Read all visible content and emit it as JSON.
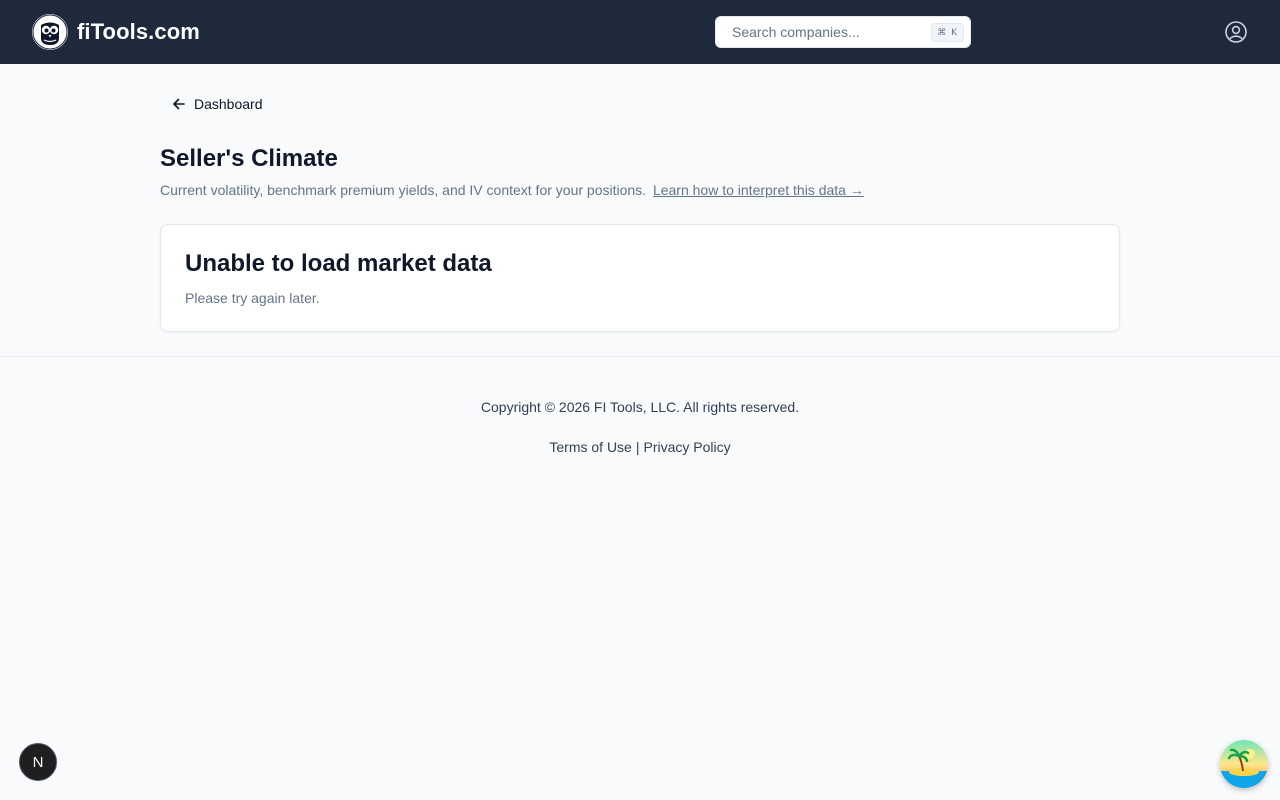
{
  "header": {
    "brand": "fiTools.com",
    "search_placeholder": "Search companies...",
    "shortcut": "⌘ K",
    "logo_icon": "owl-logo-icon",
    "user_icon": "user-circle-icon",
    "colors": {
      "background": "#1e293b",
      "text": "#ffffff"
    }
  },
  "breadcrumb": {
    "back_label": "Dashboard",
    "icon": "arrow-left-icon"
  },
  "page": {
    "title": "Seller's Climate",
    "subtitle": "Current volatility, benchmark premium yields, and IV context for your positions.",
    "learn_link": "Learn how to interpret this data →"
  },
  "error_card": {
    "title": "Unable to load market data",
    "message": "Please try again later."
  },
  "footer": {
    "copyright": "Copyright © 2026 FI Tools, LLC. All rights reserved.",
    "terms_label": "Terms of Use",
    "separator": "|",
    "privacy_label": "Privacy Policy"
  },
  "overlays": {
    "dev_badge_letter": "N",
    "dev_badge_icon": "nextjs-icon",
    "assistant_icon": "tropical-island-icon"
  },
  "colors": {
    "page_background": "#f8fafc",
    "muted_text": "#64748b",
    "card_border": "#e2e8f0"
  }
}
